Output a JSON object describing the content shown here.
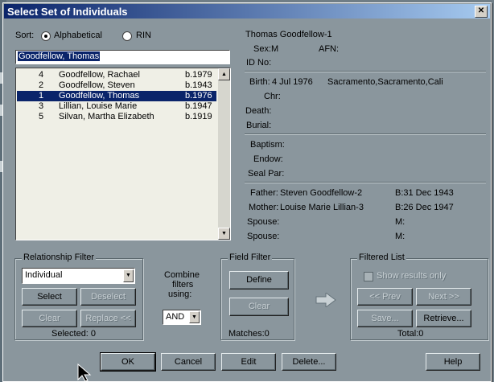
{
  "title": "Select Set of Individuals",
  "sort": {
    "label": "Sort:",
    "opt1": "Alphabetical",
    "opt2": "RIN"
  },
  "search_value": "Goodfellow, Thomas",
  "list": [
    {
      "rin": "4",
      "name": "Goodfellow, Rachael",
      "birth": "b.1979"
    },
    {
      "rin": "2",
      "name": "Goodfellow, Steven",
      "birth": "b.1943"
    },
    {
      "rin": "1",
      "name": "Goodfellow, Thomas",
      "birth": "b.1976"
    },
    {
      "rin": "3",
      "name": "Lillian, Louise Marie",
      "birth": "b.1947"
    },
    {
      "rin": "5",
      "name": "Silvan, Martha Elizabeth",
      "birth": "b.1919"
    }
  ],
  "details": {
    "name": "Thomas Goodfellow-1",
    "sex": "Sex:M",
    "afn": "AFN:",
    "idno": "ID No:",
    "birth_label": "Birth:",
    "birth_date": "4 Jul 1976",
    "birth_place": "Sacramento,Sacramento,Cali",
    "chr": "Chr:",
    "death": "Death:",
    "burial": "Burial:",
    "baptism": "Baptism:",
    "endow": "Endow:",
    "sealpar": "Seal Par:",
    "father_label": "Father:",
    "father": "Steven Goodfellow-2",
    "father_b": "B:31 Dec 1943",
    "mother_label": "Mother:",
    "mother": "Louise Marie Lillian-3",
    "mother_b": "B:26 Dec 1947",
    "spouse1": "Spouse:",
    "spouse1_m": "M:",
    "spouse2": "Spouse:",
    "spouse2_m": "M:"
  },
  "rel_filter": {
    "caption": "Relationship Filter",
    "value": "Individual",
    "select": "Select",
    "deselect": "Deselect",
    "clear": "Clear",
    "replace": "Replace <<",
    "selected": "Selected: 0"
  },
  "combine": {
    "l1": "Combine",
    "l2": "filters",
    "l3": "using:",
    "value": "AND"
  },
  "field_filter": {
    "caption": "Field Filter",
    "define": "Define",
    "clear": "Clear",
    "matches": "Matches:0"
  },
  "filtered": {
    "caption": "Filtered List",
    "show": "Show results only",
    "prev": "<< Prev",
    "next": "Next >>",
    "save": "Save...",
    "retrieve": "Retrieve...",
    "total": "Total:0"
  },
  "buttons": {
    "ok": "OK",
    "cancel": "Cancel",
    "edit": "Edit",
    "delete": "Delete...",
    "help": "Help"
  }
}
